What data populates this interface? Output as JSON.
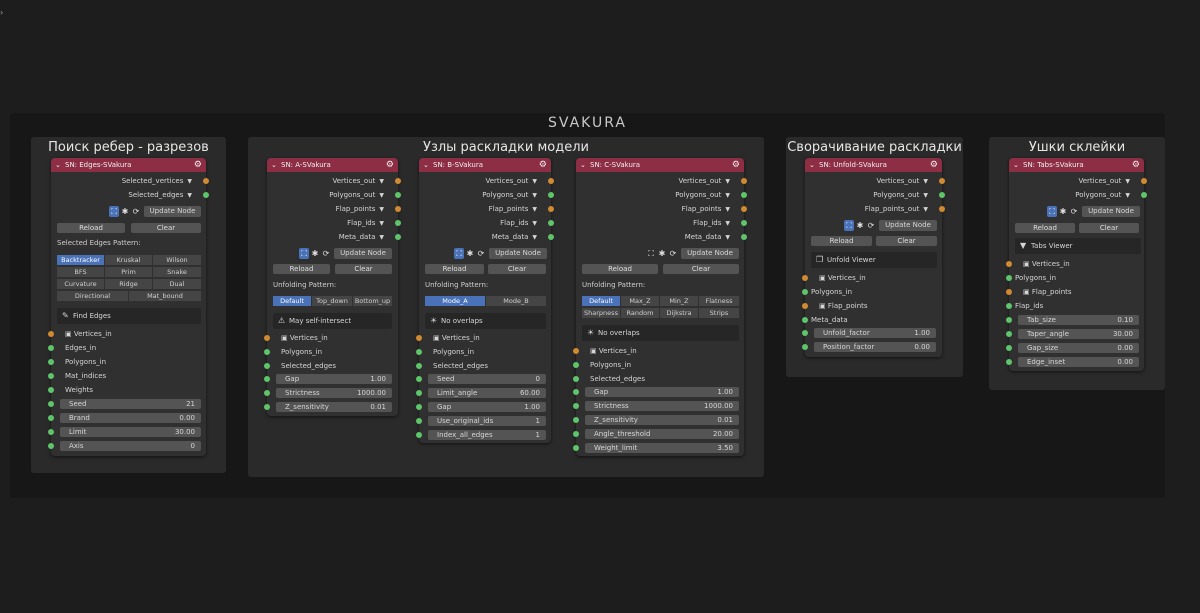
{
  "main_title": "SVAKURA",
  "common": {
    "update_node": "Update Node",
    "reload": "Reload",
    "clear": "Clear",
    "unfolding_pattern": "Unfolding Pattern:",
    "icons": [
      "node-tree-icon",
      "rig-icon",
      "refresh-icon",
      "link-icon"
    ]
  },
  "frames": {
    "edges": "Поиск ребер - разрезов",
    "unfold": "Узлы раскладки модели",
    "fold": "Сворачивание раскладки",
    "tabs": "Ушки склейки"
  },
  "edges_node": {
    "title": "SN: Edges-SVakura",
    "outputs": [
      "Selected_vertices",
      "Selected_edges"
    ],
    "pattern_label": "Selected Edges Pattern:",
    "patterns": [
      "Backtracker",
      "Kruskal",
      "Wilson",
      "BFS",
      "Prim",
      "Snake",
      "Curvature",
      "Ridge",
      "Dual",
      "Directional",
      "Mat_bound"
    ],
    "panel": "Find Edges",
    "inputs": [
      "Vertices_in",
      "Edges_in",
      "Polygons_in",
      "Mat_indices",
      "Weights"
    ],
    "fields": [
      {
        "name": "Seed",
        "value": "21"
      },
      {
        "name": "Brand",
        "value": "0.00"
      },
      {
        "name": "Limit",
        "value": "30.00"
      },
      {
        "name": "Axis",
        "value": "0"
      }
    ]
  },
  "a_node": {
    "title": "SN: A-SVakura",
    "outputs": [
      "Vertices_out",
      "Polygons_out",
      "Flap_points",
      "Flap_ids",
      "Meta_data"
    ],
    "patterns": [
      "Default",
      "Top_down",
      "Bottom_up"
    ],
    "panel": "May self-intersect",
    "inputs": [
      "Vertices_in",
      "Polygons_in",
      "Selected_edges"
    ],
    "fields": [
      {
        "name": "Gap",
        "value": "1.00"
      },
      {
        "name": "Strictness",
        "value": "1000.00"
      },
      {
        "name": "Z_sensitivity",
        "value": "0.01"
      }
    ]
  },
  "b_node": {
    "title": "SN: B-SVakura",
    "outputs": [
      "Vertices_out",
      "Polygons_out",
      "Flap_points",
      "Flap_ids",
      "Meta_data"
    ],
    "patterns": [
      "Mode_A",
      "Mode_B"
    ],
    "panel": "No overlaps",
    "inputs": [
      "Vertices_in",
      "Polygons_in",
      "Selected_edges"
    ],
    "fields": [
      {
        "name": "Seed",
        "value": "0"
      },
      {
        "name": "Limit_angle",
        "value": "60.00"
      },
      {
        "name": "Gap",
        "value": "1.00"
      },
      {
        "name": "Use_original_ids",
        "value": "1"
      },
      {
        "name": "Index_all_edges",
        "value": "1"
      }
    ]
  },
  "c_node": {
    "title": "SN: C-SVakura",
    "outputs": [
      "Vertices_out",
      "Polygons_out",
      "Flap_points",
      "Flap_ids",
      "Meta_data"
    ],
    "patterns": [
      "Default",
      "Max_Z",
      "Min_Z",
      "Flatness",
      "Sharpness",
      "Random",
      "Dijkstra",
      "Strips"
    ],
    "panel": "No overlaps",
    "inputs": [
      "Vertices_in",
      "Polygons_in",
      "Selected_edges"
    ],
    "fields": [
      {
        "name": "Gap",
        "value": "1.00"
      },
      {
        "name": "Strictness",
        "value": "1000.00"
      },
      {
        "name": "Z_sensitivity",
        "value": "0.01"
      },
      {
        "name": "Angle_threshold",
        "value": "20.00"
      },
      {
        "name": "Weight_limit",
        "value": "3.50"
      }
    ]
  },
  "unfold_node": {
    "title": "SN: Unfold-SVakura",
    "outputs": [
      "Vertices_out",
      "Polygons_out",
      "Flap_points_out"
    ],
    "panel": "Unfold Viewer",
    "inputs": [
      "Vertices_in",
      "Polygons_in",
      "Flap_points",
      "Meta_data"
    ],
    "fields": [
      {
        "name": "Unfold_factor",
        "value": "1.00"
      },
      {
        "name": "Position_factor",
        "value": "0.00"
      }
    ]
  },
  "tabs_node": {
    "title": "SN: Tabs-SVakura",
    "outputs": [
      "Vertices_out",
      "Polygons_out"
    ],
    "panel": "Tabs Viewer",
    "inputs": [
      "Vertices_in",
      "Polygons_in",
      "Flap_points",
      "Flap_ids"
    ],
    "fields": [
      {
        "name": "Tab_size",
        "value": "0.10"
      },
      {
        "name": "Taper_angle",
        "value": "30.00"
      },
      {
        "name": "Gap_size",
        "value": "0.00"
      },
      {
        "name": "Edge_inset",
        "value": "0.00"
      }
    ]
  },
  "colors": {
    "header": "#8d2e45",
    "socket_vector": "#d08a2f",
    "socket_data": "#5ec56b",
    "accent": "#4a72b8"
  }
}
